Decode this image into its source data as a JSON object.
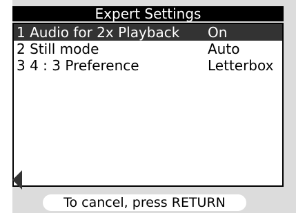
{
  "header": {
    "title": "Expert Settings"
  },
  "menu": {
    "items": [
      {
        "number": "1",
        "label": "Audio for 2x Playback",
        "value": "On",
        "selected": true
      },
      {
        "number": "2",
        "label": "Still mode",
        "value": "Auto",
        "selected": false
      },
      {
        "number": "3",
        "label": "4 : 3 Preference",
        "value": "Letterbox",
        "selected": false
      }
    ]
  },
  "footer": {
    "hint": "To cancel, press RETURN"
  },
  "icons": {
    "left_arrow": "left-triangle-icon"
  },
  "colors": {
    "osd_background": "#dcdcdc",
    "title_background": "#000000",
    "title_text": "#ffffff",
    "panel_background": "#ffffff",
    "selected_row_background": "#333333",
    "selected_row_text": "#ffffff",
    "normal_text": "#000000",
    "footer_pill_background": "#ffffff"
  }
}
